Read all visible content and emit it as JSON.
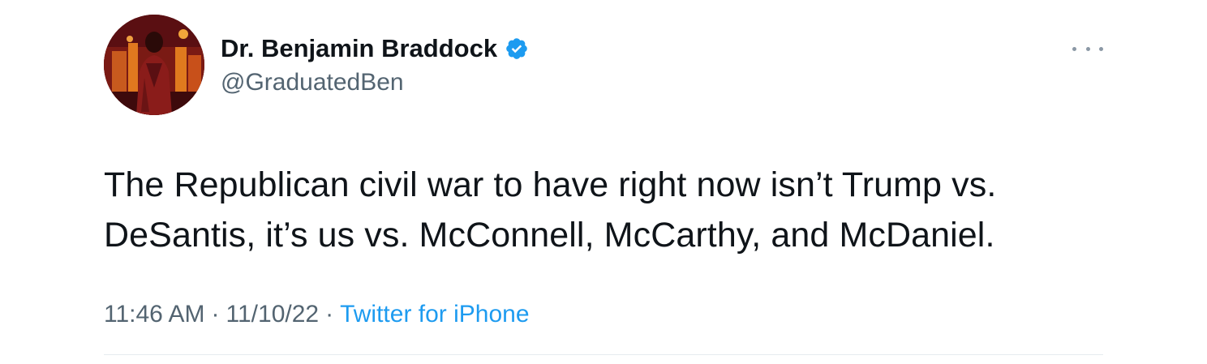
{
  "author": {
    "display_name": "Dr. Benjamin Braddock",
    "handle": "@GraduatedBen",
    "verified": true,
    "avatar_icon": "profile-avatar"
  },
  "tweet": {
    "text_lines": [
      "The Republican civil war to have right now isn’t Trump vs.",
      "DeSantis, it’s us vs. McConnell, McCarthy, and McDaniel."
    ],
    "time": "11:46 AM",
    "date": "11/10/22",
    "separator": "·",
    "source": "Twitter for iPhone"
  },
  "menu": {
    "icon": "more-options-icon"
  },
  "colors": {
    "primary_text": "#0f1419",
    "secondary_text": "#536471",
    "accent": "#1d9bf0",
    "divider": "#e6ebef"
  }
}
